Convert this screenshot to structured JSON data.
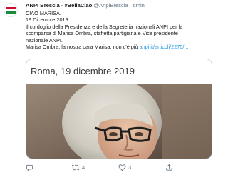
{
  "tweet": {
    "author_name": "ANPI Brescia - #BellaCiao",
    "handle": "@AnpiBrescia",
    "separator": "·",
    "time": "6min",
    "lines": [
      "CIAO MARISA.",
      "19 Dicembre 2019",
      "Il cordoglio della Presidenza e della Segreteria nazionali ANPI per la",
      "scomparsa di Marisa Ombra, staffetta partigiana e Vice presidente",
      "nazionale ANPI."
    ],
    "last_line_text": "Marisa Ombra, la nostra cara Marisa, non c'è più ",
    "link_text": "anpi.it/articoli/2270/..."
  },
  "card": {
    "title": "Roma, 19 dicembre 2019"
  },
  "actions": {
    "reply_icon": "reply-icon",
    "retweet_icon": "retweet-icon",
    "retweet_count": "4",
    "like_icon": "heart-icon",
    "like_count": "3",
    "share_icon": "share-icon"
  },
  "colors": {
    "link": "#1b95e0",
    "muted": "#657786",
    "border": "#ccd6dd"
  }
}
